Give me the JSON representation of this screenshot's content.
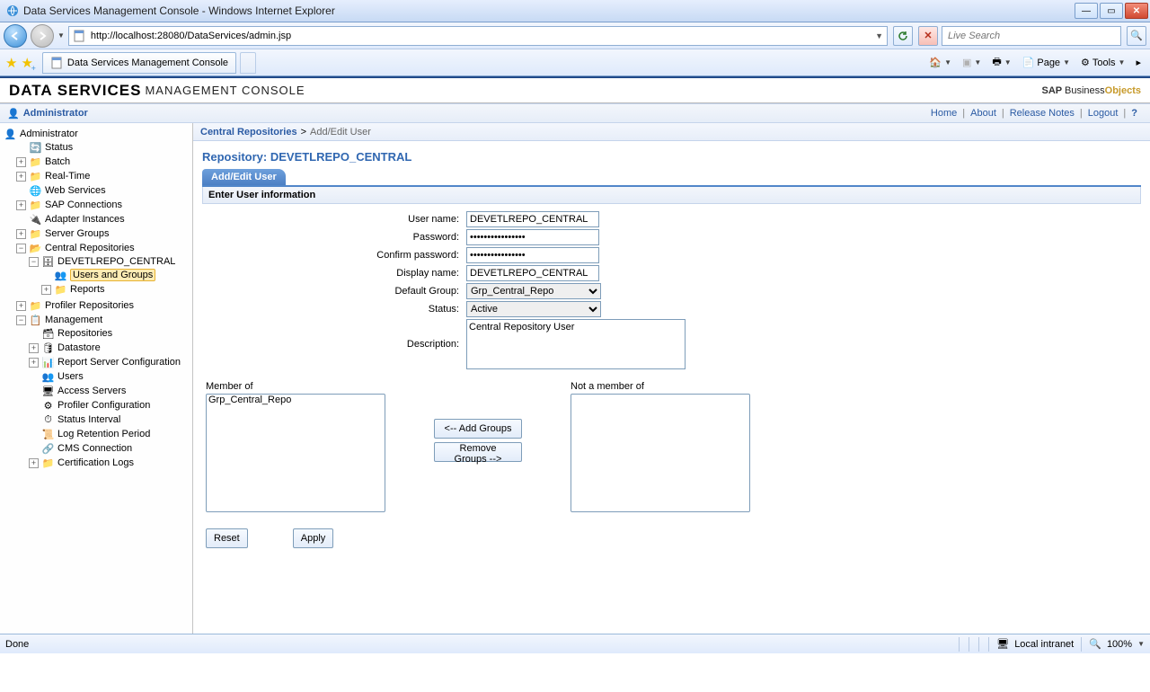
{
  "window": {
    "title": "Data Services Management Console - Windows Internet Explorer"
  },
  "url": "http://localhost:28080/DataServices/admin.jsp",
  "search_placeholder": "Live Search",
  "tab": {
    "title": "Data Services Management Console"
  },
  "toolbar": {
    "page": "Page",
    "tools": "Tools"
  },
  "app": {
    "title1": "DATA SERVICES",
    "title2": "MANAGEMENT CONSOLE",
    "logo": "SAP BusinessObjects"
  },
  "adminbar": {
    "title": "Administrator",
    "links": {
      "home": "Home",
      "about": "About",
      "release": "Release Notes",
      "logout": "Logout"
    }
  },
  "breadcrumb": {
    "a": "Central Repositories",
    "sep": ">",
    "b": "Add/Edit User"
  },
  "repo_title": "Repository: DEVETLREPO_CENTRAL",
  "formtab": "Add/Edit User",
  "section": "Enter User information",
  "labels": {
    "username": "User name:",
    "password": "Password:",
    "confirm": "Confirm password:",
    "display": "Display name:",
    "group": "Default Group:",
    "status": "Status:",
    "desc": "Description:",
    "member_of": "Member of",
    "not_member_of": "Not a member of"
  },
  "form": {
    "username": "DEVETLREPO_CENTRAL",
    "password": "••••••••••••••••",
    "confirm": "••••••••••••••••",
    "display": "DEVETLREPO_CENTRAL",
    "group": "Grp_Central_Repo",
    "status": "Active",
    "description": "Central Repository User"
  },
  "member_of": [
    "Grp_Central_Repo"
  ],
  "not_member_of": [],
  "buttons": {
    "add_groups": "<-- Add Groups",
    "remove_groups": "Remove Groups -->",
    "reset": "Reset",
    "apply": "Apply"
  },
  "tree": {
    "root": "Administrator",
    "status": "Status",
    "batch": "Batch",
    "realtime": "Real-Time",
    "web": "Web Services",
    "sap": "SAP Connections",
    "adapter": "Adapter Instances",
    "server": "Server Groups",
    "central": "Central Repositories",
    "central_repo": "DEVETLREPO_CENTRAL",
    "users_groups": "Users and Groups",
    "reports": "Reports",
    "profiler": "Profiler Repositories",
    "management": "Management",
    "repositories": "Repositories",
    "datastore": "Datastore",
    "rsc": "Report Server Configuration",
    "users": "Users",
    "access": "Access Servers",
    "profcfg": "Profiler Configuration",
    "statusint": "Status Interval",
    "logret": "Log Retention Period",
    "cms": "CMS Connection",
    "cert": "Certification Logs"
  },
  "status": {
    "done": "Done",
    "zone": "Local intranet",
    "zoom": "100%"
  }
}
